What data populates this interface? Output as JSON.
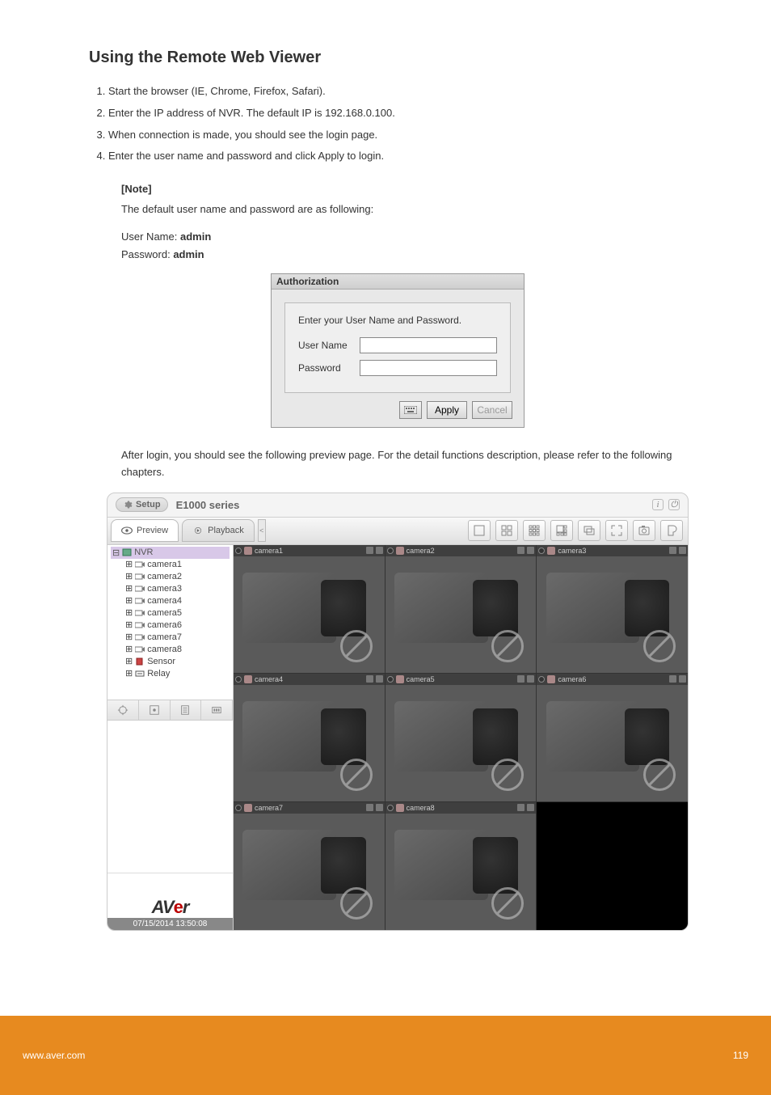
{
  "heading": "Using the Remote Web Viewer",
  "steps": [
    "Start the browser (IE, Chrome, Firefox, Safari).",
    "Enter the IP address of NVR. The default IP is 192.168.0.100.",
    "When connection is made, you should see the login page.",
    "Enter the user name and password and click Apply to login."
  ],
  "note_label": "[Note]",
  "note_body": "The default user name and password are as following:",
  "credentials": {
    "user_label": "User Name:",
    "user_value": "admin",
    "pass_label": "Password:",
    "pass_value": "admin"
  },
  "auth_dialog": {
    "title": "Authorization",
    "prompt": "Enter your User Name and Password.",
    "user_label": "User Name",
    "pass_label": "Password",
    "apply": "Apply",
    "cancel": "Cancel"
  },
  "after_login": "After login, you should see the following preview page. For the detail functions description, please refer to the following chapters.",
  "viewer": {
    "setup": "Setup",
    "model": "E1000 series",
    "tabs": {
      "preview": "Preview",
      "playback": "Playback"
    },
    "tree": {
      "root": "NVR",
      "items": [
        "camera1",
        "camera2",
        "camera3",
        "camera4",
        "camera5",
        "camera6",
        "camera7",
        "camera8",
        "Sensor",
        "Relay"
      ]
    },
    "cells": [
      "camera1",
      "camera2",
      "camera3",
      "camera4",
      "camera5",
      "camera6",
      "camera7",
      "camera8"
    ],
    "logo_a": "AV",
    "logo_b": "e",
    "logo_c": "r",
    "timestamp": "07/15/2014 13:50:08"
  },
  "footer": {
    "left": "www.aver.com",
    "right": "119"
  }
}
